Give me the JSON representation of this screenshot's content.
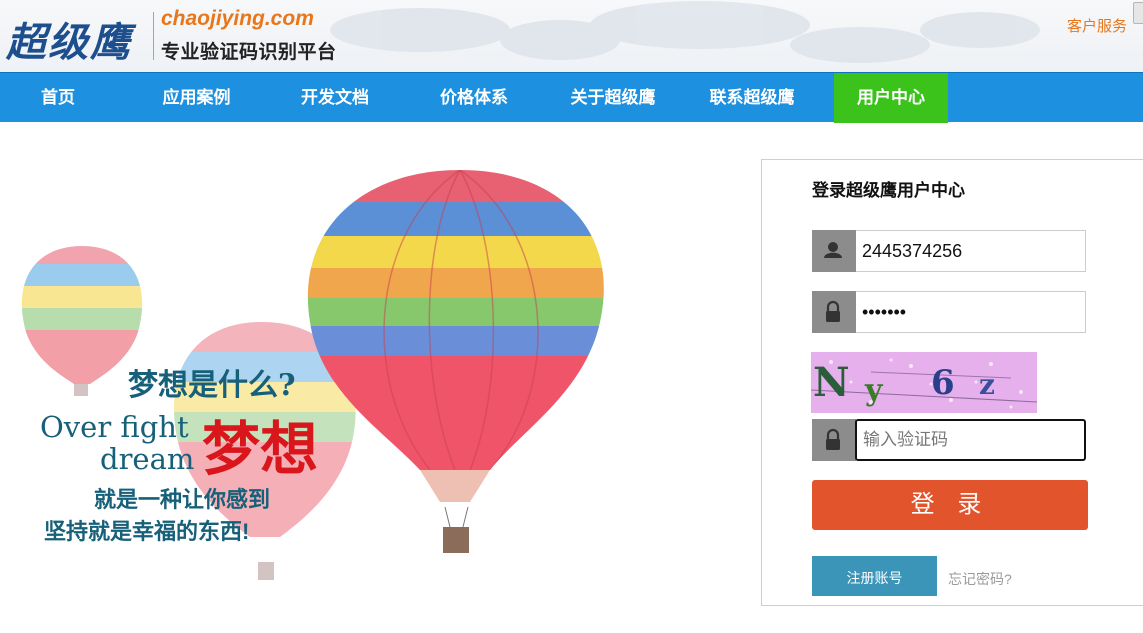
{
  "header": {
    "logo_text": "超级鹰",
    "logo_url": "chaojiying.com",
    "logo_subtitle": "专业验证码识别平台",
    "service_link": "客户服务"
  },
  "nav": {
    "items": [
      {
        "label": "首页",
        "active": false
      },
      {
        "label": "应用案例",
        "active": false
      },
      {
        "label": "开发文档",
        "active": false
      },
      {
        "label": "价格体系",
        "active": false
      },
      {
        "label": "关于超级鹰",
        "active": false
      },
      {
        "label": "联系超级鹰",
        "active": false
      },
      {
        "label": "用户中心",
        "active": true
      }
    ],
    "active_color": "#3bc21b",
    "bar_color": "#1e90e0"
  },
  "banner": {
    "line1": "梦想是什么?",
    "english_line1": "Over fight",
    "english_line2": "dream",
    "big_text": "梦想",
    "line2": "就是一种让你感到",
    "line3": "坚持就是幸福的东西!"
  },
  "login": {
    "title": "登录超级鹰用户中心",
    "username_value": "2445374256",
    "password_value": "•••••••",
    "captcha_text": "Ny 6z",
    "captcha_placeholder": "输入验证码",
    "submit_label": "登 录",
    "register_label": "注册账号",
    "forgot_label": "忘记密码?",
    "submit_color": "#e1542c",
    "register_color": "#3a95b8"
  }
}
